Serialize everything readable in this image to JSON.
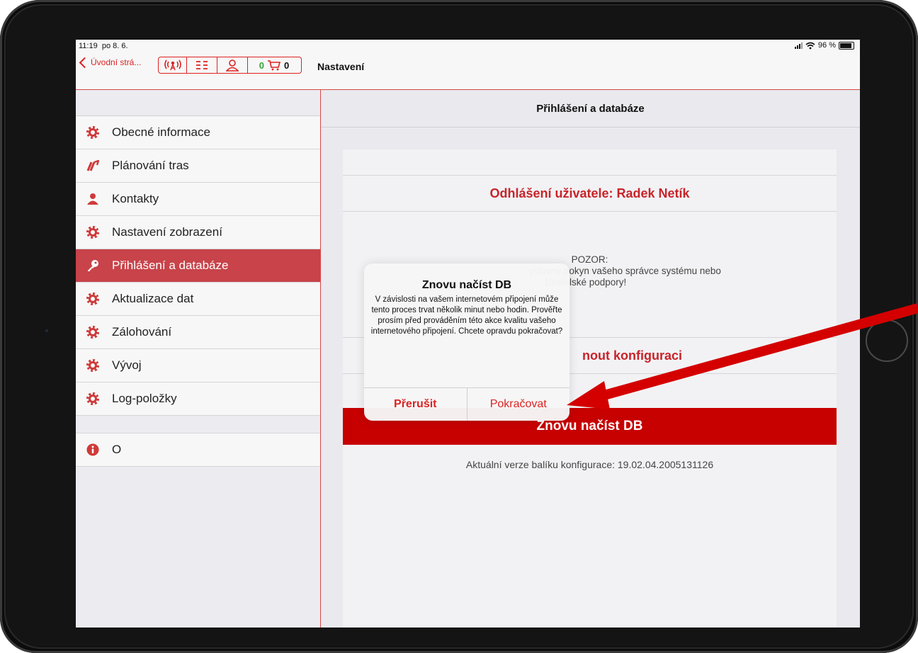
{
  "status_bar": {
    "time": "11:19",
    "date": "po 8. 6.",
    "battery": "96 %"
  },
  "nav": {
    "back_label": "Úvodní strá...",
    "cart_left": "0",
    "cart_right": "0",
    "title": "Nastavení"
  },
  "sidebar": {
    "items": [
      {
        "label": "Obecné informace",
        "icon": "gear-icon"
      },
      {
        "label": "Plánování tras",
        "icon": "route-icon"
      },
      {
        "label": "Kontakty",
        "icon": "person-icon"
      },
      {
        "label": "Nastavení zobrazení",
        "icon": "gear-icon"
      },
      {
        "label": "Přihlášení a databáze",
        "icon": "key-icon",
        "active": true
      },
      {
        "label": "Aktualizace dat",
        "icon": "gear-icon"
      },
      {
        "label": "Zálohování",
        "icon": "gear-icon"
      },
      {
        "label": "Vývoj",
        "icon": "gear-icon"
      },
      {
        "label": "Log-položky",
        "icon": "gear-icon"
      }
    ],
    "about": {
      "label": "O",
      "icon": "info-icon"
    }
  },
  "main": {
    "header": "Přihlášení a databáze",
    "logout_label": "Odhlášení uživatele: Radek Netík",
    "warning_title": "POZOR:",
    "warning_line1": "ýslovný pokyn vašeho správce systému nebo",
    "warning_line2": "živatelské podpory!",
    "config_label": "nout konfiguraci",
    "reload_label": "Znovu načíst DB",
    "version_text": "Aktuální verze balíku konfigurace: 19.02.04.2005131126"
  },
  "alert": {
    "title": "Znovu načíst DB",
    "message": "V závislosti na vašem internetovém připojení může tento proces trvat několik minut nebo hodin. Prověřte prosím před prováděním této akce kvalitu vašeho internetového připojení. Chcete opravdu pokračovat?",
    "cancel_label": "Přerušit",
    "confirm_label": "Pokračovat"
  },
  "colors": {
    "accent": "#d22222",
    "active_row": "#c8434a",
    "button": "#c70000",
    "annotation_arrow": "#d40000"
  }
}
